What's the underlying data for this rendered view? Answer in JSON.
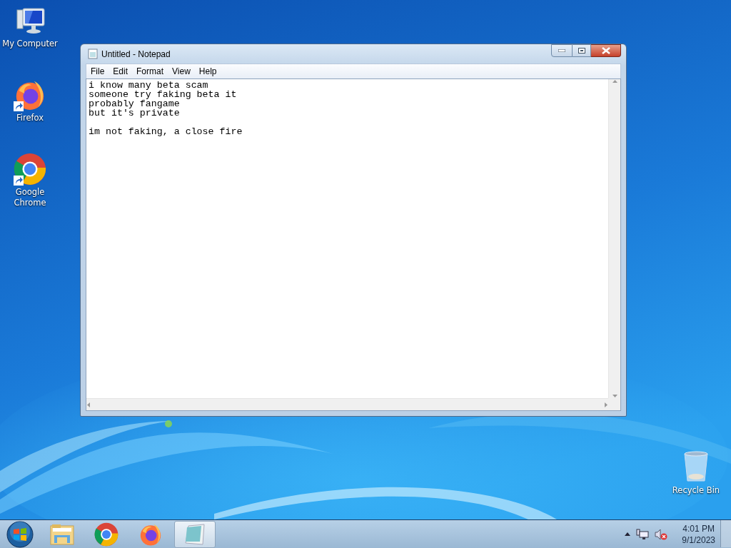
{
  "desktop_icons": [
    {
      "kind": "computer",
      "label": "My Computer"
    },
    {
      "kind": "firefox",
      "label": "Firefox"
    },
    {
      "kind": "chrome",
      "label": "Google Chrome"
    },
    {
      "kind": "recycle",
      "label": "Recycle Bin"
    }
  ],
  "window": {
    "title": "Untitled - Notepad",
    "menu": [
      "File",
      "Edit",
      "Format",
      "View",
      "Help"
    ],
    "paragraphs": [
      [
        "i know many beta scam",
        "someone try faking beta it",
        "probably fangame",
        "but it's private"
      ],
      [
        "im not faking, a close fire"
      ]
    ]
  },
  "taskbar": {
    "items": [
      {
        "kind": "explorer",
        "selected": false
      },
      {
        "kind": "chrome",
        "selected": false
      },
      {
        "kind": "firefox",
        "selected": false
      },
      {
        "kind": "notepad",
        "selected": true
      }
    ],
    "time": "4:01 PM",
    "date": "9/1/2023"
  }
}
